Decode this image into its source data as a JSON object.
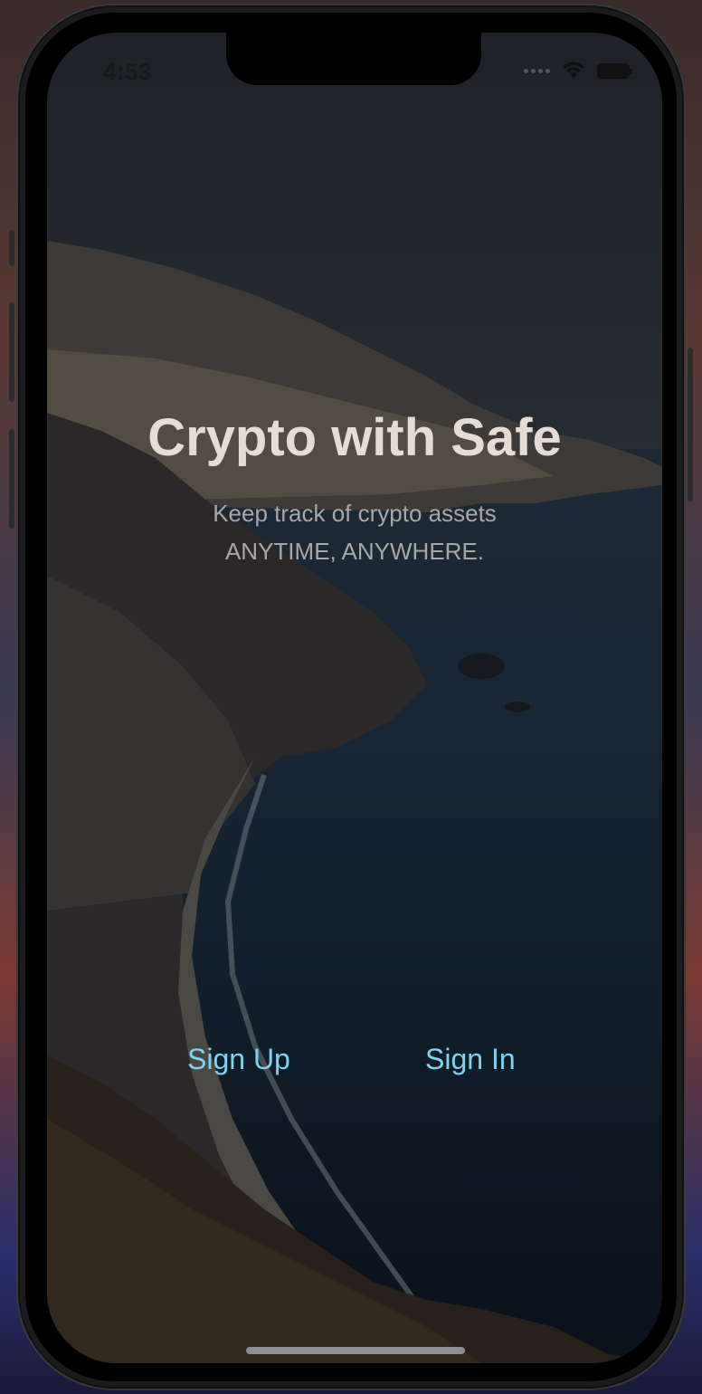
{
  "status_bar": {
    "time": "4:53",
    "icons": [
      "signal-dots-icon",
      "wifi-icon",
      "battery-icon"
    ]
  },
  "hero": {
    "title": "Crypto with Safe",
    "subtitle_line1": "Keep track of crypto assets",
    "subtitle_line2": "ANYTIME, ANYWHERE."
  },
  "actions": {
    "sign_up_label": "Sign Up",
    "sign_in_label": "Sign In"
  },
  "colors": {
    "accent": "#7dd3f0",
    "title": "#e6dcd6",
    "subtitle": "#a9a6a6"
  }
}
